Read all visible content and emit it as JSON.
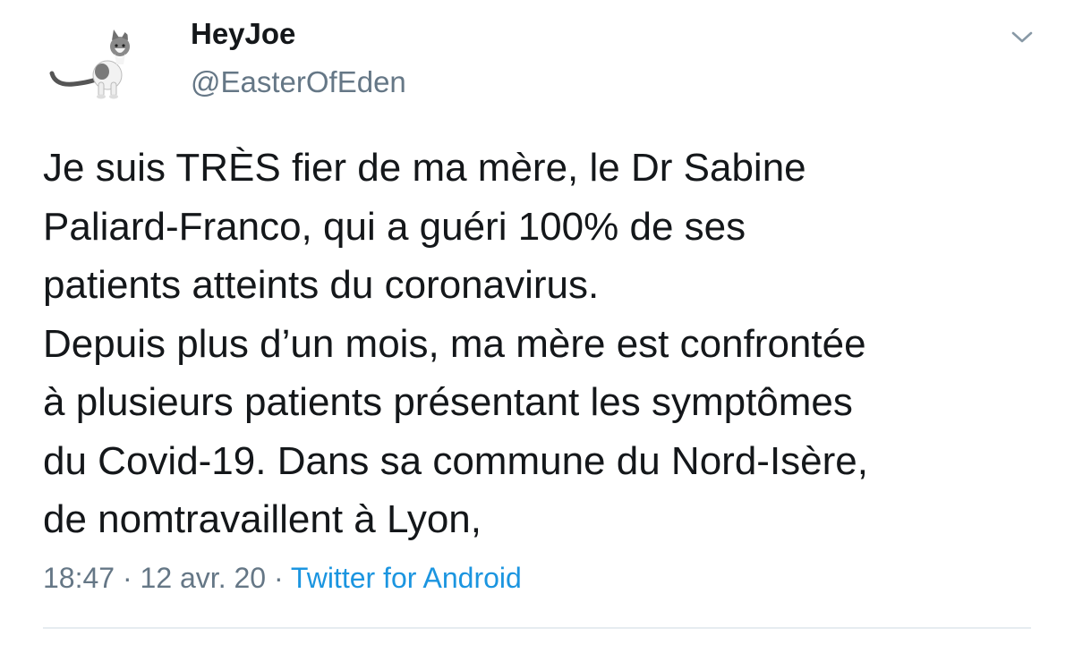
{
  "author": {
    "display_name": "HeyJoe",
    "handle": "@EasterOfEden",
    "avatar_icon": "cat-avatar-icon"
  },
  "menu_icon": "chevron-down-icon",
  "tweet": {
    "lines": [
      "Je suis TRÈS fier de ma mère, le Dr Sabine",
      "Paliard-Franco, qui a guéri 100% de ses",
      "patients atteints du coronavirus.",
      "Depuis plus d’un mois, ma mère est confrontée",
      "à plusieurs patients présentant les symptômes",
      "du Covid-19. Dans sa commune du Nord-Isère,",
      "de nomtravaillent à Lyon,"
    ],
    "time": "18:47",
    "separator": "·",
    "date": "12 avr. 20",
    "source": "Twitter for Android"
  },
  "colors": {
    "text": "#14171a",
    "secondary": "#657786",
    "link": "#1b95e0",
    "divider": "#e6ecf0"
  }
}
